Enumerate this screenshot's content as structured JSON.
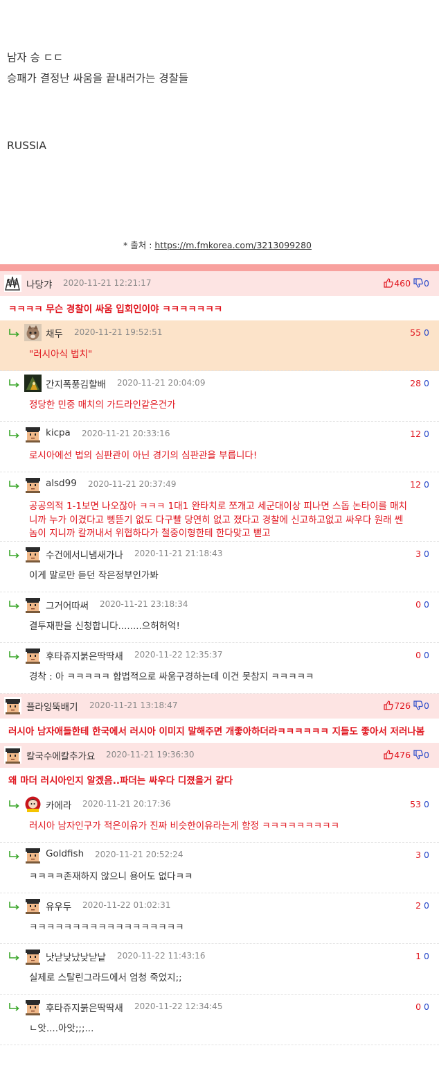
{
  "post": {
    "line1": "남자 승 ㄷㄷ",
    "line2": "승패가 결정난 싸움을 끝내러가는 경찰들",
    "line3": "RUSSIA",
    "source_prefix": "* 출처 : ",
    "source_link": "https://m.fmkorea.com/3213099280"
  },
  "colors": {
    "accent_red": "#e0151e",
    "downvote_blue": "#2748c9",
    "top_comment_bg": "#fde4e3",
    "best_reply_bg": "#fce3c9",
    "divider": "#f8a19e"
  },
  "threads": [
    {
      "avatar": "crowd-avatar",
      "nick": "나당갸",
      "date": "2020-11-21 12:21:17",
      "up": "460",
      "down": "0",
      "text": "ㅋㅋㅋㅋ 무슨 경찰이 싸움 입회인이야 ㅋㅋㅋㅋㅋㅋㅋ",
      "replies": [
        {
          "avatar": "cat-avatar",
          "nick": "채두",
          "date": "2020-11-21 19:52:51",
          "up": "55",
          "down": "0",
          "text": "\"러시아식 법치\"",
          "best": true
        },
        {
          "avatar": "dark-avatar",
          "nick": "간지폭풍김할배",
          "date": "2020-11-21 20:04:09",
          "up": "28",
          "down": "0",
          "text": "정당한 민중 매치의 가드라인같은건가"
        },
        {
          "avatar": "pixel-avatar",
          "nick": "kicpa",
          "date": "2020-11-21 20:33:16",
          "up": "12",
          "down": "0",
          "text": "로시아에선 법의 심판관이 아닌 경기의 심판관을 부릅니다!"
        },
        {
          "avatar": "pixel-avatar",
          "nick": "alsd99",
          "date": "2020-11-21 20:37:49",
          "up": "12",
          "down": "0",
          "text": "공공의적 1-1보면 나오잖아 ㅋㅋㅋ 1대1 완타치로 쪼개고 세군대이상 피나면 스돕 논타이를 매치니까 누가 이겼다고 삥뜯기 없도 다구빨 당연히 없고 졌다고 경찰에 신고하고없고 싸우다 원래 쎈놈이 지니까 칼꺼내서 위협하다가 철중이형한테 한다맞고 뻗고"
        },
        {
          "avatar": "pixel-avatar",
          "nick": "수건에서니냄새가나",
          "date": "2020-11-21 21:18:43",
          "up": "3",
          "down": "0",
          "text": "이게 말로만 듣던 작은정부인가봐",
          "normal": true
        },
        {
          "avatar": "pixel-avatar",
          "nick": "그거어따써",
          "date": "2020-11-21 23:18:34",
          "up": "0",
          "down": "0",
          "text": "결투재판을 신청합니다........으허허억!",
          "normal": true
        },
        {
          "avatar": "pixel-avatar",
          "nick": "후타쥬지붉은딱딱새",
          "date": "2020-11-22 12:35:37",
          "up": "0",
          "down": "0",
          "text": "경착 : 아 ㅋㅋㅋㅋㅋ 합법적으로 싸움구경하는데 이건 못참지 ㅋㅋㅋㅋㅋ",
          "normal": true
        }
      ]
    },
    {
      "avatar": "pixel-avatar",
      "nick": "플라잉뚝배기",
      "date": "2020-11-21 13:18:47",
      "up": "726",
      "down": "0",
      "text": "러시아 남자애들한테 한국에서 러시아 이미지 말해주면 개좋아하더라ㅋㅋㅋㅋㅋㅋ 지들도 좋아서 저러나봄",
      "replies": []
    },
    {
      "avatar": "pixel-avatar",
      "nick": "칼국수에칼추가요",
      "date": "2020-11-21 19:36:30",
      "up": "476",
      "down": "0",
      "text": "왜 마더 러시아인지 알겠음..파더는 싸우다 디졌을거 같다",
      "replies": [
        {
          "avatar": "red-avatar",
          "nick": "카에라",
          "date": "2020-11-21 20:17:36",
          "up": "53",
          "down": "0",
          "text": "러시아 남자인구가 적은이유가 진짜 비슷한이유라는게 함정 ㅋㅋㅋㅋㅋㅋㅋㅋㅋ"
        },
        {
          "avatar": "pixel-avatar",
          "nick": "Goldfish",
          "date": "2020-11-21 20:52:24",
          "up": "3",
          "down": "0",
          "text": "ㅋㅋㅋㅋ존재하지 않으니 용어도 없다ㅋㅋ",
          "normal": true
        },
        {
          "avatar": "pixel-avatar",
          "nick": "유우두",
          "date": "2020-11-22 01:02:31",
          "up": "2",
          "down": "0",
          "text": "ㅋㅋㅋㅋㅋㅋㅋㅋㅋㅋㅋㅋㅋㅋㅋㅋㅋㅋ",
          "normal": true
        },
        {
          "avatar": "pixel-avatar",
          "nick": "낫낟낮났낮낟낱",
          "date": "2020-11-22 11:43:16",
          "up": "1",
          "down": "0",
          "text": "실제로 스탈린그라드에서 엄청 죽었지;;",
          "normal": true
        },
        {
          "avatar": "pixel-avatar",
          "nick": "후타쥬지붉은딱딱새",
          "date": "2020-11-22 12:34:45",
          "up": "0",
          "down": "0",
          "text": "ㄴ앗....아앗;;;...",
          "normal": true
        }
      ]
    }
  ]
}
